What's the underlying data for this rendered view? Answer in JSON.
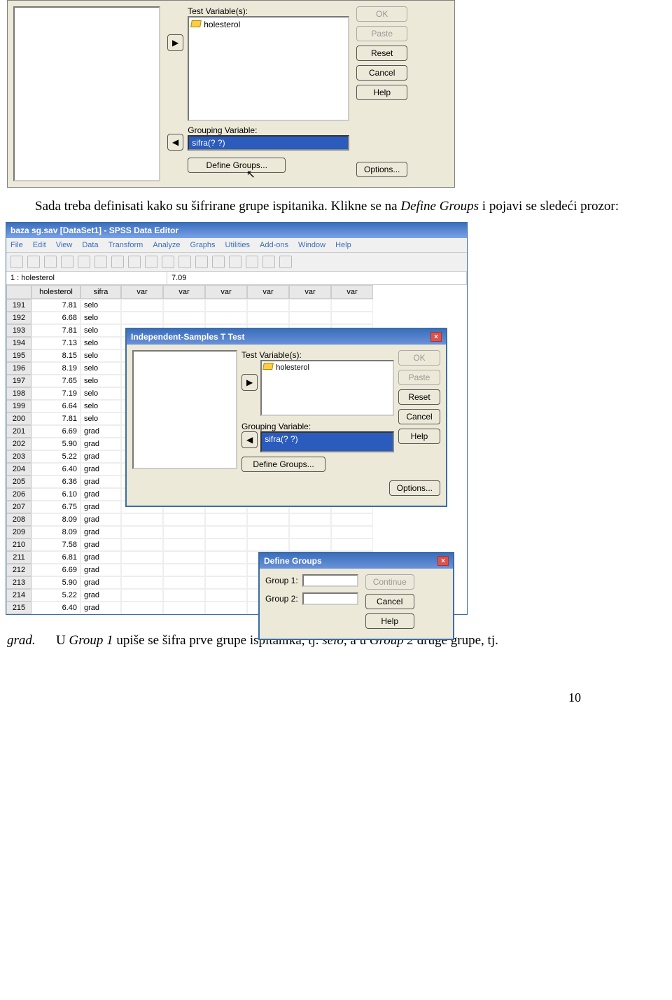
{
  "topDialog": {
    "testVarLabel": "Test Variable(s):",
    "testVar": "holesterol",
    "groupVarLabel": "Grouping Variable:",
    "groupVar": "sifra(? ?)",
    "defineGroups": "Define Groups...",
    "btns": {
      "ok": "OK",
      "paste": "Paste",
      "reset": "Reset",
      "cancel": "Cancel",
      "help": "Help",
      "options": "Options..."
    },
    "arrowRight": "▶",
    "arrowLeft": "◀"
  },
  "para1": {
    "full": "Sada treba definisati kako su šifrirane grupe ispitanika. Klikne se na Define Groups i pojavi se sledeći prozor:"
  },
  "spss": {
    "title": "baza sg.sav [DataSet1] - SPSS Data Editor",
    "menu": [
      "File",
      "Edit",
      "View",
      "Data",
      "Transform",
      "Analyze",
      "Graphs",
      "Utilities",
      "Add-ons",
      "Window",
      "Help"
    ],
    "cellref": "1 : holesterol",
    "cellval": "7.09",
    "cols": [
      "",
      "holesterol",
      "sifra",
      "var",
      "var",
      "var",
      "var",
      "var",
      "var"
    ],
    "rows": [
      [
        191,
        7.81,
        "selo"
      ],
      [
        192,
        6.68,
        "selo"
      ],
      [
        193,
        7.81,
        "selo"
      ],
      [
        194,
        7.13,
        "selo"
      ],
      [
        195,
        8.15,
        "selo"
      ],
      [
        196,
        8.19,
        "selo"
      ],
      [
        197,
        7.65,
        "selo"
      ],
      [
        198,
        7.19,
        "selo"
      ],
      [
        199,
        6.64,
        "selo"
      ],
      [
        200,
        7.81,
        "selo"
      ],
      [
        201,
        6.69,
        "grad"
      ],
      [
        202,
        5.9,
        "grad"
      ],
      [
        203,
        5.22,
        "grad"
      ],
      [
        204,
        6.4,
        "grad"
      ],
      [
        205,
        6.36,
        "grad"
      ],
      [
        206,
        6.1,
        "grad"
      ],
      [
        207,
        6.75,
        "grad"
      ],
      [
        208,
        8.09,
        "grad"
      ],
      [
        209,
        8.09,
        "grad"
      ],
      [
        210,
        7.58,
        "grad"
      ],
      [
        211,
        6.81,
        "grad"
      ],
      [
        212,
        6.69,
        "grad"
      ],
      [
        213,
        5.9,
        "grad"
      ],
      [
        214,
        5.22,
        "grad"
      ],
      [
        215,
        6.4,
        "grad"
      ]
    ]
  },
  "indSamples": {
    "title": "Independent-Samples T Test",
    "testVarLabel": "Test Variable(s):",
    "testVar": "holesterol",
    "groupVarLabel": "Grouping Variable:",
    "groupVar": "sifra(? ?)",
    "defineGroups": "Define Groups...",
    "btns": {
      "ok": "OK",
      "paste": "Paste",
      "reset": "Reset",
      "cancel": "Cancel",
      "help": "Help",
      "options": "Options..."
    }
  },
  "defineGroups": {
    "title": "Define Groups",
    "g1": "Group 1:",
    "g2": "Group 2:",
    "btns": {
      "continue": "Continue",
      "cancel": "Cancel",
      "help": "Help"
    }
  },
  "para2a": "grad.",
  "para2b_pre": "U ",
  "para2b_g1": "Group 1",
  "para2b_mid": " upiše se šifra prve grupe ispitanika, tj. ",
  "para2b_selo": "selo,",
  "para2b_mid2": " a u ",
  "para2b_g2": "Group 2",
  "para2b_end": " druge grupe, tj.",
  "pageNumber": "10"
}
